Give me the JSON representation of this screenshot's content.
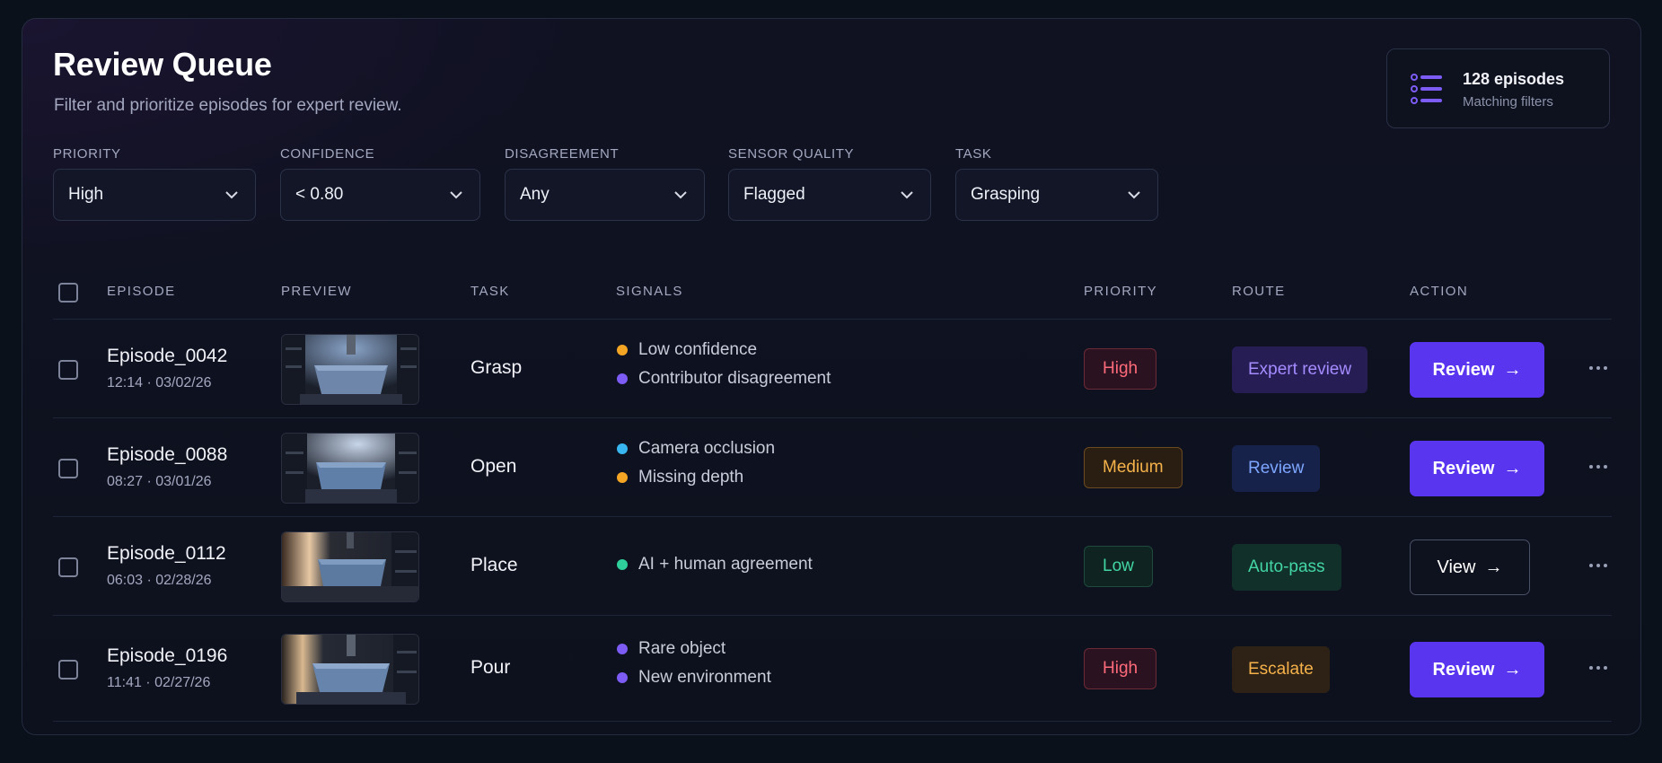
{
  "header": {
    "title": "Review Queue",
    "subtitle": "Filter and prioritize episodes for expert review.",
    "count_title": "128 episodes",
    "count_subtitle": "Matching filters",
    "count_icon": "list-icon"
  },
  "filters": [
    {
      "label": "PRIORITY",
      "value": "High"
    },
    {
      "label": "CONFIDENCE",
      "value": "< 0.80"
    },
    {
      "label": "DISAGREEMENT",
      "value": "Any"
    },
    {
      "label": "SENSOR QUALITY",
      "value": "Flagged"
    },
    {
      "label": "TASK",
      "value": "Grasping"
    }
  ],
  "columns": {
    "episode": "EPISODE",
    "preview": "PREVIEW",
    "task": "TASK",
    "signals": "SIGNALS",
    "priority": "PRIORITY",
    "route": "ROUTE",
    "action": "ACTION"
  },
  "rows": [
    {
      "name": "Episode_0042",
      "time": "12:14 · 03/02/26",
      "task": "Grasp",
      "signals": [
        {
          "text": "Low confidence",
          "color": "#f5a524"
        },
        {
          "text": "Contributor disagreement",
          "color": "#7c5cf5"
        }
      ],
      "priority": "High",
      "route": "Expert review",
      "action": "Review",
      "action_style": "primary"
    },
    {
      "name": "Episode_0088",
      "time": "08:27 · 03/01/26",
      "task": "Open",
      "signals": [
        {
          "text": "Camera occlusion",
          "color": "#38b6f0"
        },
        {
          "text": "Missing depth",
          "color": "#f5a524"
        }
      ],
      "priority": "Medium",
      "route": "Review",
      "action": "Review",
      "action_style": "primary"
    },
    {
      "name": "Episode_0112",
      "time": "06:03 · 02/28/26",
      "task": "Place",
      "signals": [
        {
          "text": "AI + human agreement",
          "color": "#2ecf9a"
        }
      ],
      "priority": "Low",
      "route": "Auto-pass",
      "action": "View",
      "action_style": "ghost"
    },
    {
      "name": "Episode_0196",
      "time": "11:41 · 02/27/26",
      "task": "Pour",
      "signals": [
        {
          "text": "Rare object",
          "color": "#7c5cf5"
        },
        {
          "text": "New environment",
          "color": "#7c5cf5"
        }
      ],
      "priority": "High",
      "route": "Escalate",
      "action": "Review",
      "action_style": "primary"
    }
  ],
  "arrow": "→",
  "colors": {
    "accent": "#5a35f0",
    "high": "#ff6b7a",
    "medium": "#f5b24a",
    "low": "#43d6a4"
  }
}
